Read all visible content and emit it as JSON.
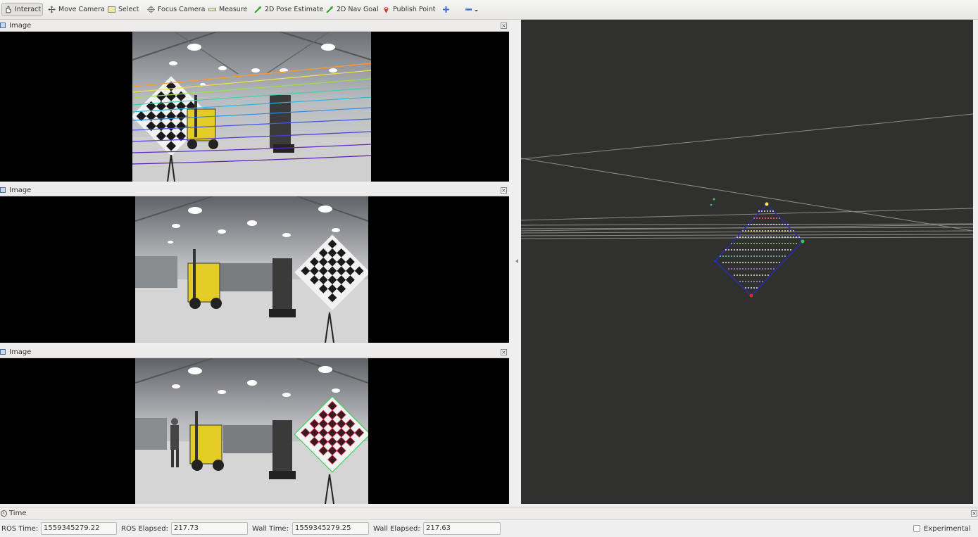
{
  "toolbar": {
    "tools": [
      {
        "label": "Interact",
        "icon": "hand-cursor-icon"
      },
      {
        "label": "Move Camera",
        "icon": "move-arrows-icon"
      },
      {
        "label": "Select",
        "icon": "select-box-icon"
      },
      {
        "label": "Focus Camera",
        "icon": "crosshair-icon"
      },
      {
        "label": "Measure",
        "icon": "ruler-icon"
      },
      {
        "label": "2D Pose Estimate",
        "icon": "green-arrow-icon"
      },
      {
        "label": "2D Nav Goal",
        "icon": "green-arrow-icon"
      },
      {
        "label": "Publish Point",
        "icon": "map-pin-icon"
      }
    ]
  },
  "panels": [
    {
      "title": "Image"
    },
    {
      "title": "Image"
    },
    {
      "title": "Image"
    }
  ],
  "time_panel": {
    "title": "Time",
    "ros_time_label": "ROS Time:",
    "ros_time_value": "1559345279.22",
    "ros_elapsed_label": "ROS Elapsed:",
    "ros_elapsed_value": "217.73",
    "wall_time_label": "Wall Time:",
    "wall_time_value": "1559345279.25",
    "wall_elapsed_label": "Wall Elapsed:",
    "wall_elapsed_value": "217.63",
    "experimental_label": "Experimental",
    "experimental_checked": false
  },
  "colors": {
    "view_background": "#30302f",
    "forklift_yellow": "#e2cc25",
    "pattern_outline": "#2a2ab8"
  }
}
